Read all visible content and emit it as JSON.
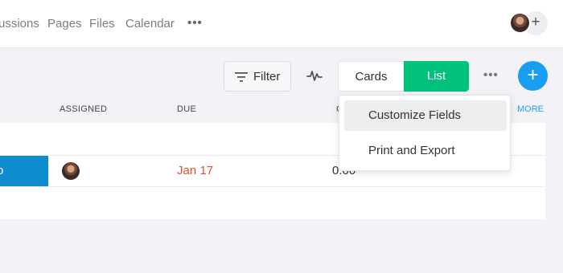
{
  "nav": {
    "links": [
      "ussions",
      "Pages",
      "Files",
      "Calendar"
    ],
    "more": "•••",
    "add_member": "+"
  },
  "toolbar": {
    "filter_label": "Filter",
    "view_cards": "Cards",
    "view_list": "List",
    "more": "•••",
    "add": "+"
  },
  "columns": {
    "assigned": "ASSIGNED",
    "due": "DUE",
    "partial": "C",
    "more": "MORE"
  },
  "rows": [
    {
      "task_fragment": "o",
      "due": "Jan 17",
      "time": "0:00"
    }
  ],
  "menu": {
    "items": [
      "Customize Fields",
      "Print and Export"
    ]
  },
  "colors": {
    "accent_green": "#00c27a",
    "accent_blue": "#1a9ff0",
    "task_blue": "#0f8ccd",
    "due_red": "#ee4b2b"
  }
}
